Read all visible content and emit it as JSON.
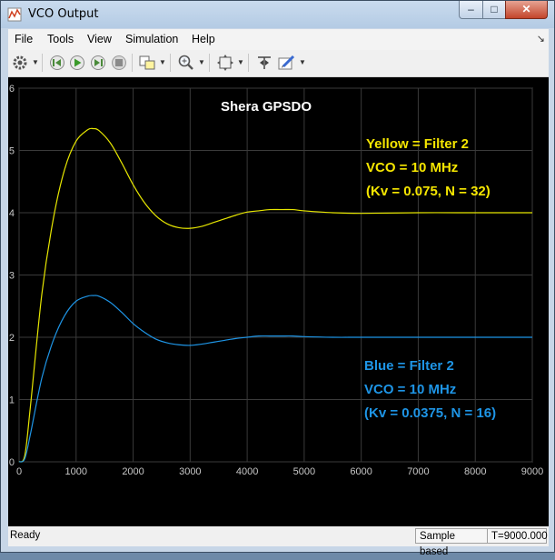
{
  "window": {
    "title": "VCO Output",
    "minimize": "–",
    "maximize": "□",
    "close": "✕"
  },
  "menu": {
    "items": [
      "File",
      "Tools",
      "View",
      "Simulation",
      "Help"
    ]
  },
  "toolbar": {
    "icons": [
      "parameters-gear-icon",
      "step-back-icon",
      "run-icon",
      "stop-icon",
      "highlight-icon",
      "zoom-icon",
      "fit-to-view-icon",
      "cursor-measure-icon",
      "style-pen-icon"
    ]
  },
  "plot": {
    "title": "Shera GPSDO",
    "annotation_yellow": [
      "Yellow = Filter 2",
      "VCO = 10 MHz",
      "(Kv = 0.075, N = 32)"
    ],
    "annotation_blue": [
      "Blue = Filter 2",
      "VCO = 10 MHz",
      "(Kv = 0.0375, N = 16)"
    ],
    "colors": {
      "yellow": "#e6e600",
      "blue": "#1e95e6",
      "title": "#ffffff",
      "label_yellow": "#f5e600",
      "label_blue": "#1e95e6",
      "grid": "#3a3a3a",
      "ticks": "#c8c8c8"
    }
  },
  "chart_data": {
    "type": "line",
    "title": "Shera GPSDO",
    "xlabel": "",
    "ylabel": "",
    "xlim": [
      0,
      9000
    ],
    "ylim": [
      0,
      6
    ],
    "grid": true,
    "x_ticks": [
      0,
      1000,
      2000,
      3000,
      4000,
      5000,
      6000,
      7000,
      8000,
      9000
    ],
    "y_ticks": [
      0,
      1,
      2,
      3,
      4,
      5,
      6
    ],
    "series": [
      {
        "name": "Yellow = Filter 2",
        "color": "#e6e600",
        "x": [
          0,
          100,
          200,
          400,
          600,
          800,
          1000,
          1200,
          1300,
          1400,
          1600,
          1800,
          2000,
          2200,
          2400,
          2600,
          2800,
          3000,
          3200,
          3400,
          3600,
          3800,
          4000,
          4200,
          4400,
          4600,
          4800,
          5000,
          5500,
          6000,
          7000,
          8000,
          9000
        ],
        "y": [
          0,
          0.1,
          0.9,
          2.7,
          3.9,
          4.7,
          5.15,
          5.33,
          5.35,
          5.32,
          5.12,
          4.8,
          4.45,
          4.16,
          3.95,
          3.82,
          3.76,
          3.75,
          3.78,
          3.84,
          3.9,
          3.96,
          4.01,
          4.03,
          4.05,
          4.05,
          4.05,
          4.03,
          4.0,
          3.99,
          4.0,
          4.0,
          4.0
        ]
      },
      {
        "name": "Blue = Filter 2",
        "color": "#1e95e6",
        "x": [
          0,
          100,
          200,
          400,
          600,
          800,
          1000,
          1200,
          1300,
          1400,
          1600,
          1800,
          2000,
          2200,
          2400,
          2600,
          2800,
          3000,
          3200,
          3400,
          3600,
          3800,
          4000,
          4200,
          4400,
          4600,
          4800,
          5000,
          5500,
          6000,
          7000,
          8000,
          9000
        ],
        "y": [
          0,
          0.05,
          0.45,
          1.35,
          1.95,
          2.35,
          2.58,
          2.66,
          2.67,
          2.66,
          2.56,
          2.4,
          2.22,
          2.08,
          1.97,
          1.91,
          1.88,
          1.87,
          1.89,
          1.92,
          1.95,
          1.98,
          2.0,
          2.02,
          2.02,
          2.02,
          2.02,
          2.01,
          2.0,
          2.0,
          2.0,
          2.0,
          2.0
        ]
      }
    ]
  },
  "status": {
    "left": "Ready",
    "mode": "Sample based",
    "time": "T=9000.000"
  }
}
